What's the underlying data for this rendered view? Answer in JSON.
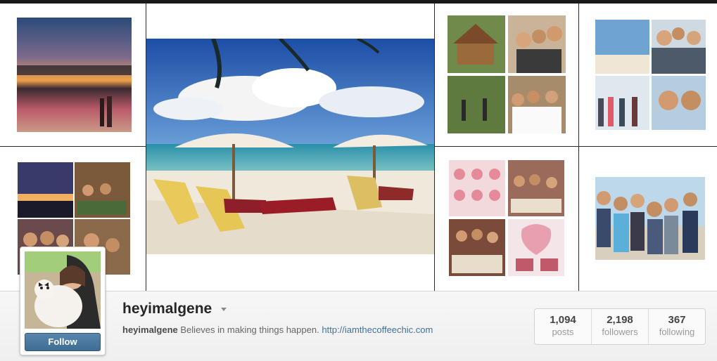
{
  "profile": {
    "username": "heyimalgene",
    "follow_label": "Follow",
    "bio_user": "heyimalgene",
    "bio_text": "Believes in making things happen.",
    "bio_link": "http://iamthecoffeechic.com"
  },
  "stats": [
    {
      "value": "1,094",
      "label": "posts"
    },
    {
      "value": "2,198",
      "label": "followers"
    },
    {
      "value": "367",
      "label": "following"
    }
  ],
  "colors": {
    "link": "#3f729b",
    "follow_button": "#4a7aa3"
  }
}
